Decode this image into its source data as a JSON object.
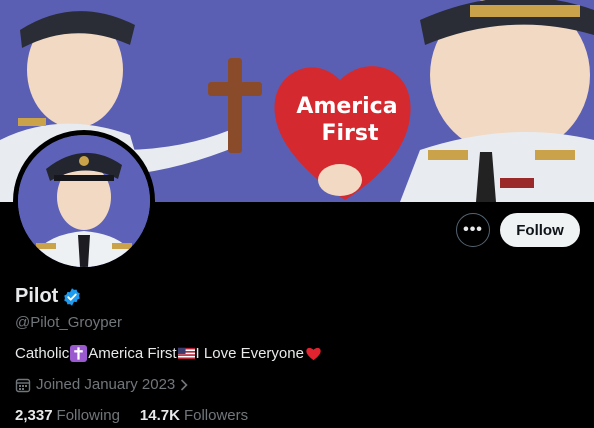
{
  "banner": {
    "heart_line1": "America",
    "heart_line2": "First",
    "background_color": "#5a5fb4"
  },
  "actions": {
    "more_label": "•••",
    "follow_label": "Follow"
  },
  "profile": {
    "name": "Pilot",
    "verified_icon": "verified-badge-icon",
    "handle": "@Pilot_Groyper",
    "bio": {
      "part1": "Catholic",
      "emoji1": "latin-cross",
      "part2": "America First",
      "emoji2": "us-flag",
      "part3": "I Love Everyone",
      "emoji3": "red-heart"
    },
    "joined": "Joined January 2023"
  },
  "stats": {
    "following_count": "2,337",
    "following_label": "Following",
    "followers_count": "14.7K",
    "followers_label": "Followers"
  },
  "colors": {
    "accent_verified": "#1d9bf0",
    "secondary_text": "#71767b",
    "follow_bg": "#eff3f4"
  }
}
